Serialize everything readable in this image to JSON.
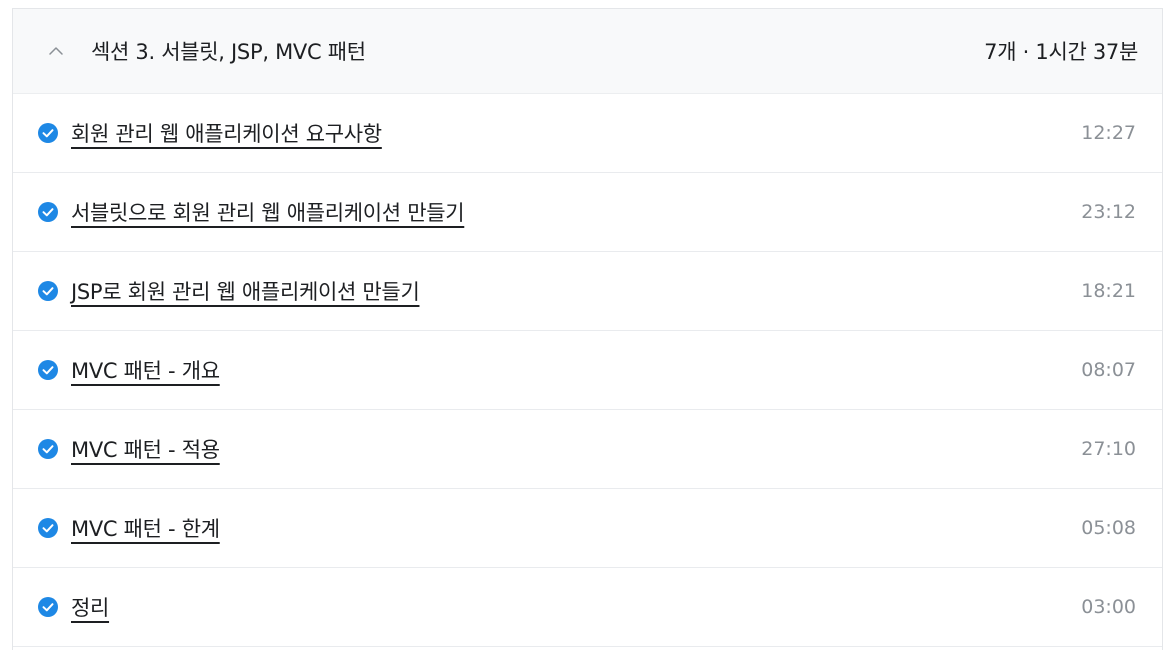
{
  "section": {
    "title": "섹션 3. 서블릿, JSP, MVC 패턴",
    "meta": "7개 · 1시간 37분",
    "chevron_icon": "chevron-up-icon"
  },
  "colors": {
    "check": "#1e88e5",
    "header_bg": "#f8f9fa",
    "duration": "#8b9096"
  },
  "lectures": [
    {
      "title": "회원 관리 웹 애플리케이션 요구사항",
      "duration": "12:27",
      "icon": "check-circle-icon"
    },
    {
      "title": "서블릿으로 회원 관리 웹 애플리케이션 만들기",
      "duration": "23:12",
      "icon": "check-circle-icon"
    },
    {
      "title": "JSP로 회원 관리 웹 애플리케이션 만들기",
      "duration": "18:21",
      "icon": "check-circle-icon"
    },
    {
      "title": "MVC 패턴 - 개요",
      "duration": "08:07",
      "icon": "check-circle-icon"
    },
    {
      "title": "MVC 패턴 - 적용",
      "duration": "27:10",
      "icon": "check-circle-icon"
    },
    {
      "title": "MVC 패턴 - 한계",
      "duration": "05:08",
      "icon": "check-circle-icon"
    },
    {
      "title": "정리",
      "duration": "03:00",
      "icon": "check-circle-icon"
    }
  ]
}
